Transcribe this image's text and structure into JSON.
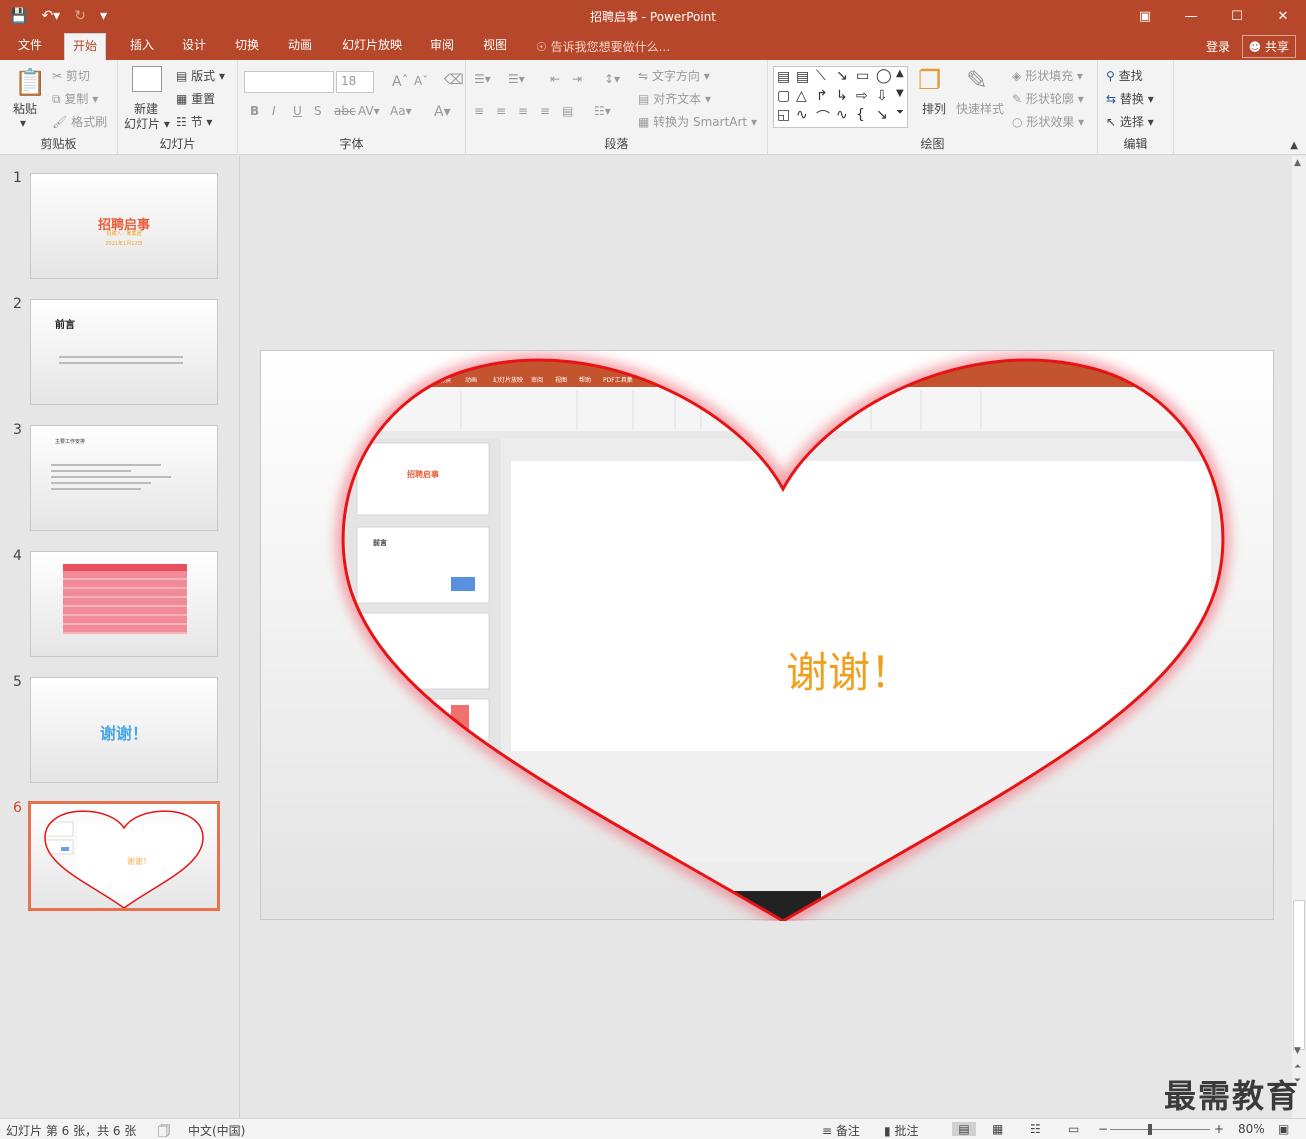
{
  "window": {
    "title": "招聘启事 - PowerPoint"
  },
  "tabs": [
    "文件",
    "开始",
    "插入",
    "设计",
    "切换",
    "动画",
    "幻灯片放映",
    "审阅",
    "视图"
  ],
  "tell_me": "告诉我您想要做什么...",
  "login": "登录",
  "share": "共享",
  "ribbon": {
    "clipboard": {
      "paste": "粘贴",
      "cut": "剪切",
      "copy": "复制",
      "format_painter": "格式刷",
      "label": "剪贴板"
    },
    "slides": {
      "new_slide": "新建",
      "new_slide2": "幻灯片",
      "layout": "版式",
      "reset": "重置",
      "section": "节",
      "label": "幻灯片"
    },
    "font": {
      "font_size": "18",
      "label": "字体"
    },
    "paragraph": {
      "text_direction": "文字方向",
      "align_text": "对齐文本",
      "smartart": "转换为 SmartArt",
      "label": "段落"
    },
    "drawing": {
      "arrange": "排列",
      "quick_styles": "快速样式",
      "fill": "形状填充",
      "outline": "形状轮廓",
      "effects": "形状效果",
      "label": "绘图"
    },
    "editing": {
      "find": "查找",
      "replace": "替换",
      "select": "选择",
      "label": "编辑"
    }
  },
  "thumbnails": [
    {
      "num": "1",
      "title": "招聘启事",
      "sub": "招聘人：某集团",
      "date": "2021年1月12日"
    },
    {
      "num": "2",
      "title": "前言"
    },
    {
      "num": "3",
      "title": "主要工作安排"
    },
    {
      "num": "4",
      "title": "表格"
    },
    {
      "num": "5",
      "title": "谢谢！"
    },
    {
      "num": "6",
      "title": "谢谢！"
    }
  ],
  "slide": {
    "inner_tabs": [
      "切换",
      "动画",
      "幻灯片放映",
      "审阅",
      "视图",
      "帮助",
      "PDF工具集"
    ],
    "inner_thumb1_title": "招聘启事",
    "inner_thumb2_title": "前言",
    "thanks": "谢谢！"
  },
  "status": {
    "slide_info": "幻灯片 第 6 张，共 6 张",
    "language": "中文(中国)",
    "notes": "备注",
    "comments": "批注",
    "zoom": "80%"
  },
  "watermark": "最需教育",
  "colors": {
    "accent": "#b7472a",
    "heart_stroke": "#e61414",
    "thanks_color": "#f0a020"
  }
}
